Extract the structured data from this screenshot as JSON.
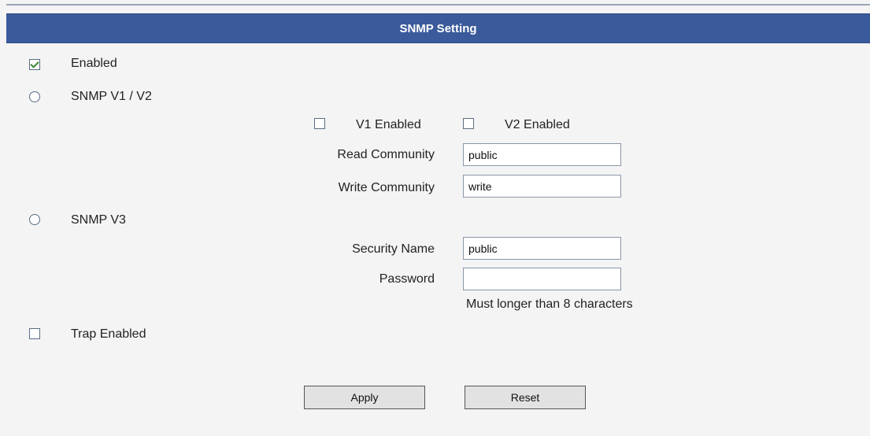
{
  "header": {
    "title": "SNMP Setting"
  },
  "enabled": {
    "label": "Enabled",
    "checked": true
  },
  "snmp_v1v2": {
    "label": "SNMP V1 / V2",
    "v1_label": "V1 Enabled",
    "v2_label": "V2 Enabled",
    "read_community_label": "Read Community",
    "read_community_value": "public",
    "write_community_label": "Write Community",
    "write_community_value": "write"
  },
  "snmp_v3": {
    "label": "SNMP V3",
    "security_name_label": "Security Name",
    "security_name_value": "public",
    "password_label": "Password",
    "password_value": "",
    "password_hint": "Must longer than 8 characters"
  },
  "trap": {
    "label": "Trap Enabled"
  },
  "buttons": {
    "apply": "Apply",
    "reset": "Reset"
  }
}
